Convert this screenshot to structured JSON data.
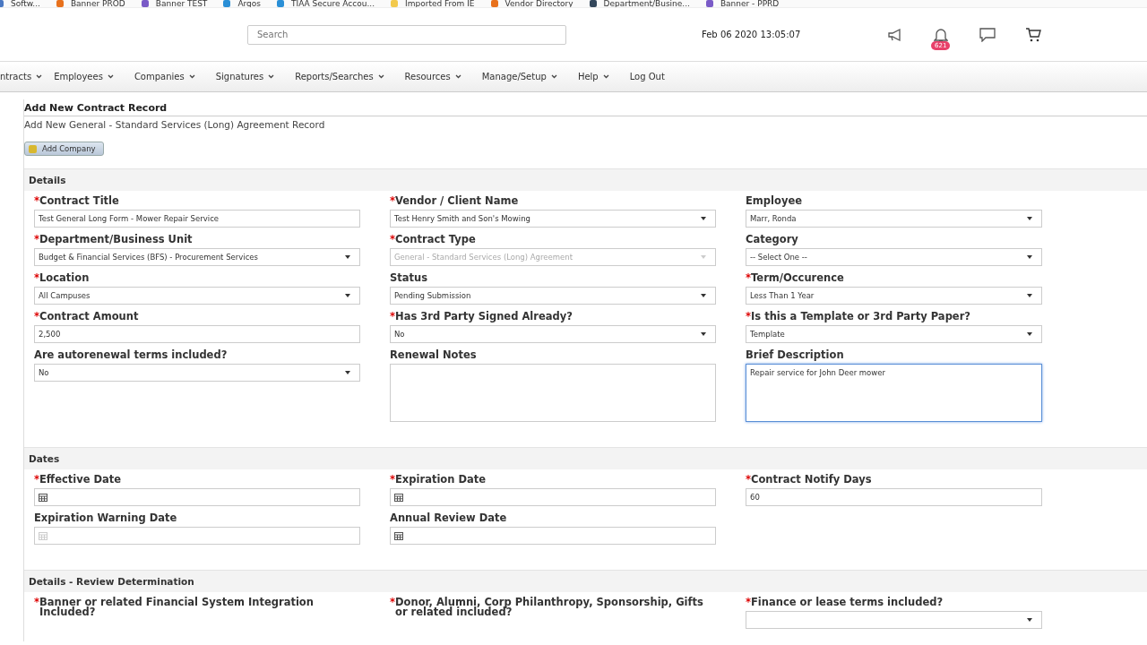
{
  "bookmarks": [
    {
      "label": "Softw...",
      "color": "#4a78c2"
    },
    {
      "label": "Banner PROD",
      "color": "#e8711c"
    },
    {
      "label": "Banner TEST",
      "color": "#7a5bc7"
    },
    {
      "label": "Argos",
      "color": "#2a8fd6"
    },
    {
      "label": "TIAA Secure Accou...",
      "color": "#2a8fd6"
    },
    {
      "label": "Imported From IE",
      "color": "#f2c94c"
    },
    {
      "label": "Vendor Directory",
      "color": "#e8711c"
    },
    {
      "label": "Department/Busine...",
      "color": "#33475b"
    },
    {
      "label": "Banner - PPRD",
      "color": "#7a5bc7"
    }
  ],
  "header": {
    "search": {
      "placeholder": "Search"
    },
    "datetime": "Feb 06 2020 13:05:07",
    "notification_count": "621"
  },
  "nav": [
    "ntracts",
    "Employees",
    "Companies",
    "Signatures",
    "Reports/Searches",
    "Resources",
    "Manage/Setup",
    "Help",
    "Log Out"
  ],
  "page": {
    "title": "Add New Contract Record",
    "subtitle": "Add New General - Standard Services (Long) Agreement Record",
    "add_button": "Add Company"
  },
  "sections": [
    {
      "title": "Details",
      "fields": [
        {
          "label": "Contract Title",
          "required": true,
          "kind": "text",
          "value": "Test General Long Form - Mower Repair Service"
        },
        {
          "label": "Vendor / Client Name",
          "required": true,
          "kind": "select",
          "value": "Test Henry Smith and Son's Mowing"
        },
        {
          "label": "Employee",
          "required": false,
          "kind": "select",
          "value": "Marr, Ronda"
        },
        {
          "label": "Department/Business Unit",
          "required": true,
          "kind": "select",
          "value": "Budget & Financial Services (BFS) - Procurement Services"
        },
        {
          "label": "Contract Type",
          "required": true,
          "kind": "select",
          "value": "General - Standard Services (Long) Agreement",
          "disabled": true
        },
        {
          "label": "Category",
          "required": false,
          "kind": "select",
          "value": "-- Select One --"
        },
        {
          "label": "Location",
          "required": true,
          "kind": "select",
          "value": "All Campuses"
        },
        {
          "label": "Status",
          "required": false,
          "kind": "select",
          "value": "Pending Submission"
        },
        {
          "label": "Term/Occurence",
          "required": true,
          "kind": "select",
          "value": "Less Than 1 Year"
        },
        {
          "label": "Contract Amount",
          "required": true,
          "kind": "text",
          "value": "2,500"
        },
        {
          "label": "Has 3rd Party Signed Already?",
          "required": true,
          "kind": "select",
          "value": "No"
        },
        {
          "label": "Is this a Template or 3rd Party Paper?",
          "required": true,
          "kind": "select",
          "value": "Template"
        },
        {
          "label": "Are autorenewal terms included?",
          "required": false,
          "kind": "select",
          "value": "No"
        },
        {
          "label": "Renewal Notes",
          "required": false,
          "kind": "textarea"
        },
        {
          "label": "Brief Description",
          "required": false,
          "kind": "textarea",
          "value": "Repair service for John Deer mower",
          "focused": true
        }
      ]
    },
    {
      "title": "Dates",
      "fields": [
        {
          "label": "Effective Date",
          "required": true,
          "kind": "date",
          "disabled": false
        },
        {
          "label": "Expiration Date",
          "required": true,
          "kind": "date",
          "disabled": false
        },
        {
          "label": "Contract Notify Days",
          "required": true,
          "kind": "text",
          "value": "60"
        },
        {
          "label": "Expiration Warning Date",
          "required": false,
          "kind": "date",
          "disabled": true
        },
        {
          "label": "Annual Review Date",
          "required": false,
          "kind": "date",
          "disabled": false
        }
      ]
    },
    {
      "title": "Details - Review Determination",
      "fields": [
        {
          "label": "Banner or related Financial System Integration Included?",
          "required": true,
          "kind": "none"
        },
        {
          "label": "Donor, Alumni, Corp Philanthropy, Sponsorship, Gifts or related included?",
          "required": true,
          "kind": "none"
        },
        {
          "label": "Finance or lease terms included?",
          "required": true,
          "kind": "select"
        }
      ]
    }
  ],
  "required_marker": "*"
}
